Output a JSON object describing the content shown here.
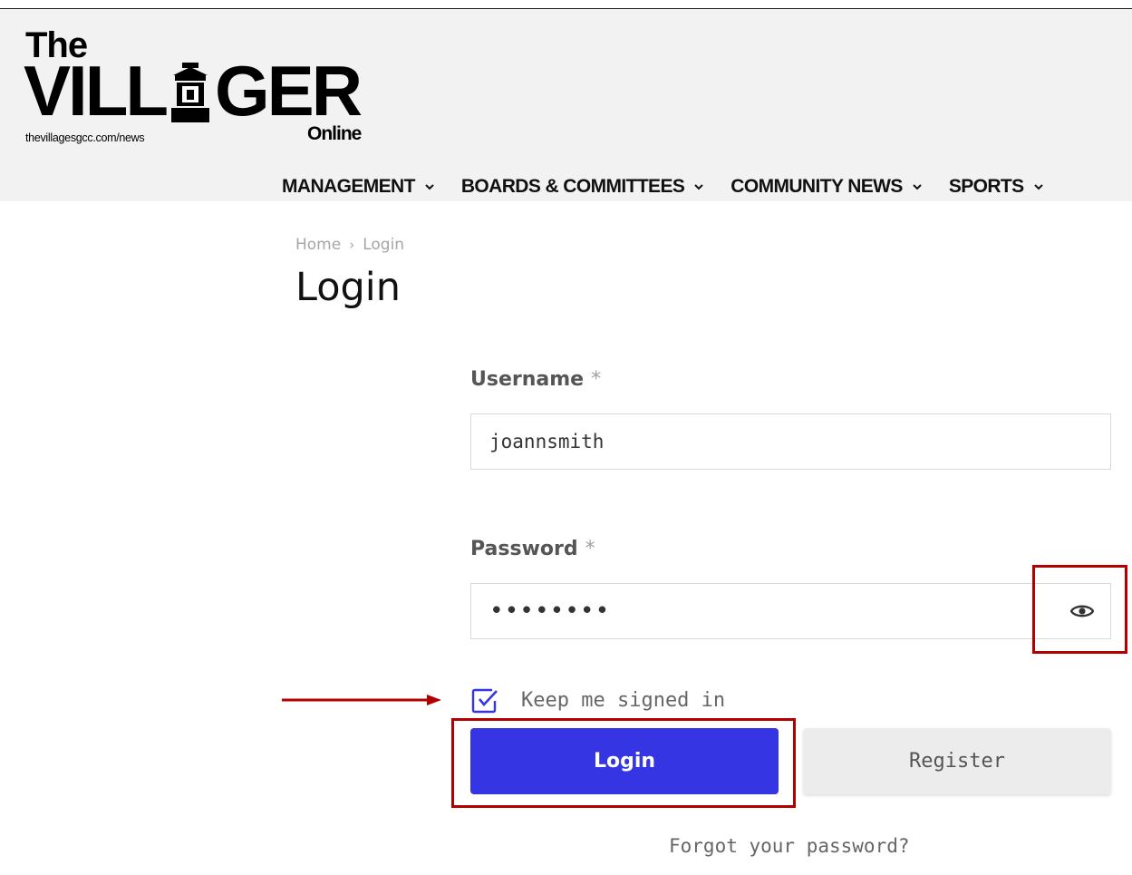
{
  "header": {
    "logo_the": "The",
    "logo_part1": "VILL",
    "logo_part2": "GER",
    "logo_online": "Online",
    "logo_url": "thevillagesgcc.com/news"
  },
  "nav": {
    "items": [
      {
        "label": "MANAGEMENT"
      },
      {
        "label": "BOARDS & COMMITTEES"
      },
      {
        "label": "COMMUNITY NEWS"
      },
      {
        "label": "SPORTS"
      }
    ]
  },
  "breadcrumb": {
    "home": "Home",
    "separator": "›",
    "current": "Login"
  },
  "page": {
    "title": "Login"
  },
  "form": {
    "username_label": "Username",
    "username_value": "joannsmith",
    "password_label": "Password",
    "password_value": "••••••••",
    "required_mark": "*",
    "keep_signed_in": "Keep me signed in",
    "keep_signed_in_checked": true,
    "login_button": "Login",
    "register_button": "Register",
    "forgot_password": "Forgot your password?"
  },
  "colors": {
    "accent": "#3535e3",
    "annotation": "#b00000",
    "header_bg": "#f2f2f2"
  },
  "icons": {
    "password_toggle": "eye-icon",
    "checkbox": "checkbox-checked-icon",
    "nav_dropdown": "chevron-down-icon",
    "logo_mark": "lantern-icon"
  }
}
